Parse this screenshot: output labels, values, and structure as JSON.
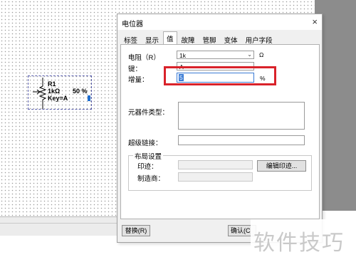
{
  "schematic": {
    "component": {
      "ref": "R1",
      "value": "1kΩ",
      "key": "Key=A",
      "percent": "50 %"
    }
  },
  "dialog": {
    "title": "电位器",
    "close_glyph": "×",
    "tabs": [
      "标签",
      "显示",
      "值",
      "故障",
      "管脚",
      "变体",
      "用户字段"
    ],
    "active_tab": "值",
    "fields": {
      "resistance_label": "电阻（R）",
      "resistance_value": "1k",
      "resistance_unit": "Ω",
      "key_label": "键：",
      "key_value": "A",
      "increment_label": "增量：",
      "increment_value": "5",
      "increment_unit": "%",
      "component_type_label": "元器件类型：",
      "hyperlink_label": "超级链接：",
      "layout_group_label": "布局设置",
      "footprint_label": "印迹：",
      "manufacturer_label": "制造商：",
      "edit_footprint_button": "编辑印迹..."
    },
    "footer": {
      "replace_button": "替换(R)",
      "ok_button": "确认(C"
    }
  },
  "watermark": "软件技巧",
  "colors": {
    "highlight_border": "#d9222a",
    "component_outline": "#5a5fae",
    "wiper_blue": "#1f6fd1"
  }
}
